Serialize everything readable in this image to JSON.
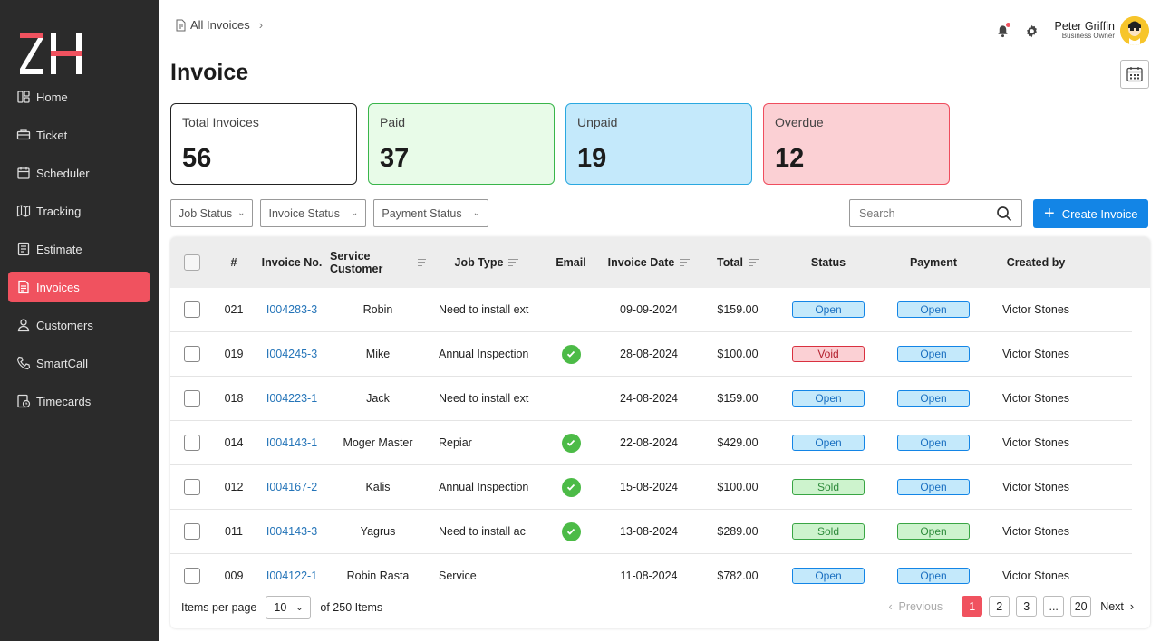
{
  "brand": {
    "logo_text": "ZH",
    "accent": "#f0525f"
  },
  "sidebar": {
    "items": [
      {
        "label": "Home",
        "icon": "home-icon"
      },
      {
        "label": "Ticket",
        "icon": "ticket-icon"
      },
      {
        "label": "Scheduler",
        "icon": "scheduler-icon"
      },
      {
        "label": "Tracking",
        "icon": "tracking-icon"
      },
      {
        "label": "Estimate",
        "icon": "estimate-icon"
      },
      {
        "label": "Invoices",
        "icon": "invoices-icon",
        "active": true
      },
      {
        "label": "Customers",
        "icon": "customers-icon"
      },
      {
        "label": "SmartCall",
        "icon": "phone-icon"
      },
      {
        "label": "Timecards",
        "icon": "timecards-icon"
      }
    ]
  },
  "header": {
    "breadcrumb": "All Invoices",
    "title": "Invoice",
    "user": {
      "name": "Peter Griffin",
      "role": "Business Owner"
    }
  },
  "stats": [
    {
      "label": "Total Invoices",
      "value": "56",
      "kind": "total"
    },
    {
      "label": "Paid",
      "value": "37",
      "kind": "paid"
    },
    {
      "label": "Unpaid",
      "value": "19",
      "kind": "unpaid"
    },
    {
      "label": "Overdue",
      "value": "12",
      "kind": "overdue"
    }
  ],
  "filters": {
    "job_status": "Job Status",
    "invoice_status": "Invoice Status",
    "payment_status": "Payment Status",
    "search_placeholder": "Search",
    "create_label": "Create Invoice"
  },
  "table": {
    "columns": [
      "#",
      "Invoice No.",
      "Service Customer",
      "Job Type",
      "Email",
      "Invoice Date",
      "Total",
      "Status",
      "Payment",
      "Created by"
    ],
    "rows": [
      {
        "num": "021",
        "invoice": "I004283-3",
        "customer": "Robin",
        "job": "Need to install ext",
        "email": false,
        "date": "09-09-2024",
        "total": "$159.00",
        "status": "Open",
        "status_color": "blue",
        "payment": "Open",
        "payment_color": "blue",
        "created_by": "Victor Stones"
      },
      {
        "num": "019",
        "invoice": "I004245-3",
        "customer": "Mike",
        "job": "Annual Inspection",
        "email": true,
        "date": "28-08-2024",
        "total": "$100.00",
        "status": "Void",
        "status_color": "red",
        "payment": "Open",
        "payment_color": "blue",
        "created_by": "Victor Stones"
      },
      {
        "num": "018",
        "invoice": "I004223-1",
        "customer": "Jack",
        "job": "Need to install ext",
        "email": false,
        "date": "24-08-2024",
        "total": "$159.00",
        "status": "Open",
        "status_color": "blue",
        "payment": "Open",
        "payment_color": "blue",
        "created_by": "Victor Stones"
      },
      {
        "num": "014",
        "invoice": "I004143-1",
        "customer": "Moger Master",
        "job": "Repiar",
        "email": true,
        "date": "22-08-2024",
        "total": "$429.00",
        "status": "Open",
        "status_color": "blue",
        "payment": "Open",
        "payment_color": "blue",
        "created_by": "Victor Stones"
      },
      {
        "num": "012",
        "invoice": "I004167-2",
        "customer": "Kalis",
        "job": "Annual Inspection",
        "email": true,
        "date": "15-08-2024",
        "total": "$100.00",
        "status": "Sold",
        "status_color": "green",
        "payment": "Open",
        "payment_color": "blue",
        "created_by": "Victor Stones"
      },
      {
        "num": "011",
        "invoice": "I004143-3",
        "customer": "Yagrus",
        "job": "Need to install ac",
        "email": true,
        "date": "13-08-2024",
        "total": "$289.00",
        "status": "Sold",
        "status_color": "green",
        "payment": "Open",
        "payment_color": "green",
        "created_by": "Victor Stones"
      },
      {
        "num": "009",
        "invoice": "I004122-1",
        "customer": "Robin Rasta",
        "job": "Service",
        "email": false,
        "date": "11-08-2024",
        "total": "$782.00",
        "status": "Open",
        "status_color": "blue",
        "payment": "Open",
        "payment_color": "blue",
        "created_by": "Victor Stones"
      }
    ]
  },
  "footer": {
    "items_per_page_label": "Items per page",
    "items_per_page": "10",
    "total_label": "of 250 Items",
    "previous": "Previous",
    "next": "Next",
    "pages": [
      "1",
      "2",
      "3",
      "...",
      "20"
    ],
    "current_page": "1"
  }
}
